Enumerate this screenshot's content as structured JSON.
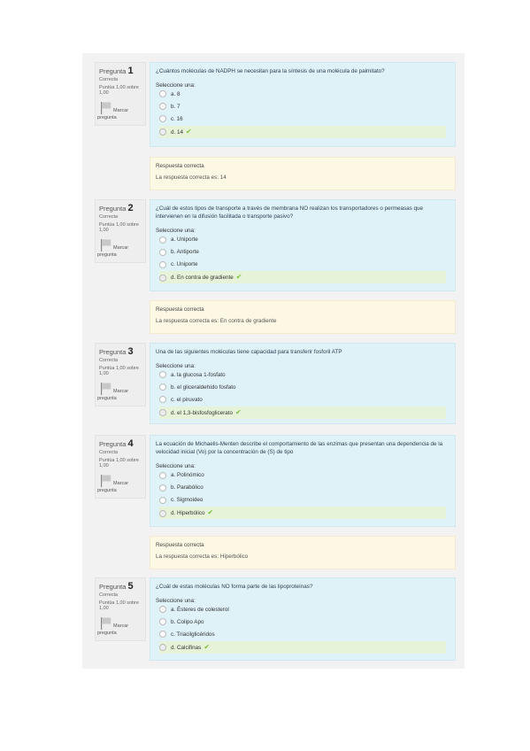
{
  "questions": [
    {
      "number_label": "Pregunta",
      "number": "1",
      "state": "Correcta",
      "grade": "Puntúa 1,00 sobre 1,00",
      "flag_label_1": "Marcar",
      "flag_label_2": "pregunta",
      "text": "¿Cuántos moléculas de NADPH se necesitan para la síntesis de una molécula de palmitato?",
      "prompt": "Seleccione una:",
      "options": [
        "a. 8",
        "b. 7",
        "c. 16",
        "d. 14"
      ],
      "selected_index": 3,
      "feedback_title": "Respuesta correcta",
      "feedback_text": "La respuesta correcta es: 14"
    },
    {
      "number_label": "Pregunta",
      "number": "2",
      "state": "Correcta",
      "grade": "Puntúa 1,00 sobre 1,00",
      "flag_label_1": "Marcar",
      "flag_label_2": "pregunta",
      "text": "¿Cuál de estos tipos de transporte a través de membrana NO realizan los transportadores o permeasas que intervienen en la difusión facilitada o transporte pasivo?",
      "prompt": "Seleccione una:",
      "options": [
        "a. Uniporte",
        "b. Antiporte",
        "c. Uniporte",
        "d. En contra de gradiente"
      ],
      "selected_index": 3,
      "feedback_title": "Respuesta correcta",
      "feedback_text": "La respuesta correcta es: En contra de gradiente"
    },
    {
      "number_label": "Pregunta",
      "number": "3",
      "state": "Correcta",
      "grade": "Puntúa 1,00 sobre 1,00",
      "flag_label_1": "Marcar",
      "flag_label_2": "pregunta",
      "text": "Una de las siguientes moléculas tiene capacidad para transferir fosforil ATP",
      "prompt": "Seleccione una:",
      "options": [
        "a. la glucosa 1-fosfato",
        "b. el gliceraldehído fosfato",
        "c. el piruvato",
        "d. el 1,3-bisfosfoglicerato"
      ],
      "selected_index": 3,
      "feedback_title": "",
      "feedback_text": ""
    },
    {
      "number_label": "Pregunta",
      "number": "4",
      "state": "Correcta",
      "grade": "Puntúa 1,00 sobre 1,00",
      "flag_label_1": "Marcar",
      "flag_label_2": "pregunta",
      "text": "La ecuación de Michaelis-Menten describe el comportamiento de las enzimas que presentan una dependencia de la velocidad inicial (Vo) por la concentración de (S) de tipo",
      "prompt": "Seleccione una:",
      "options": [
        "a. Polinómico",
        "b. Parabólico",
        "c. Sigmoideo",
        "d. Hiperbólico"
      ],
      "selected_index": 3,
      "feedback_title": "Respuesta correcta",
      "feedback_text": "La respuesta correcta es: Hiperbólico"
    },
    {
      "number_label": "Pregunta",
      "number": "5",
      "state": "Correcta",
      "grade": "Puntúa 1,00 sobre 1,00",
      "flag_label_1": "Marcar",
      "flag_label_2": "pregunta",
      "text": "¿Cuál de estas moléculas NO forma parte de las lipoproteínas?",
      "prompt": "Seleccione una:",
      "options": [
        "a. Ésteres de colesterol",
        "b. Colipo Apo",
        "c. Triacilglicéridos",
        "d. Calcifinas"
      ],
      "selected_index": 3,
      "feedback_title": "",
      "feedback_text": ""
    }
  ]
}
